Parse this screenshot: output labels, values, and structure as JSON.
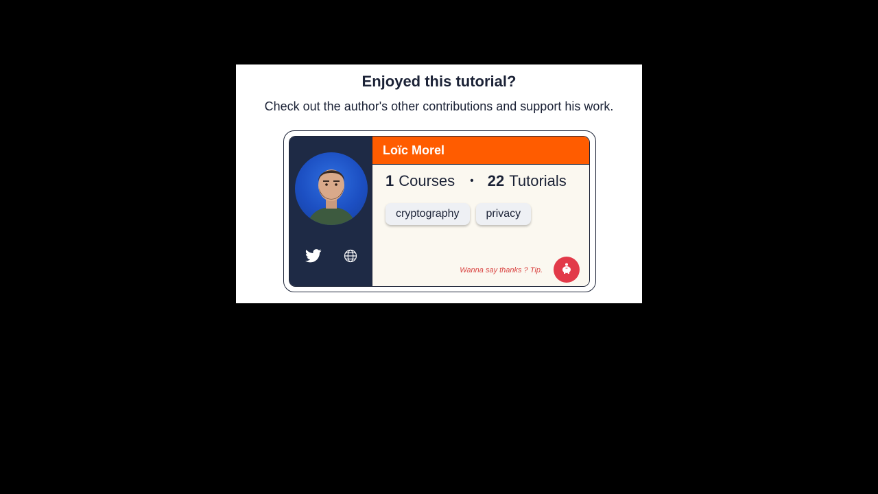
{
  "modal": {
    "title": "Enjoyed this tutorial?",
    "subtitle": "Check out the author's other contributions and support his work."
  },
  "author": {
    "name": "Loïc Morel",
    "courses_count": "1",
    "courses_label": "Courses",
    "separator": "•",
    "tutorials_count": "22",
    "tutorials_label": "Tutorials",
    "tags": [
      "cryptography",
      "privacy"
    ],
    "tip_text": "Wanna say thanks ? Tip."
  },
  "icons": {
    "twitter": "twitter-icon",
    "website": "globe-icon",
    "tip": "piggy-bank-icon"
  },
  "colors": {
    "header_orange": "#ff5c00",
    "sidebar_navy": "#1e2a45",
    "tip_red": "#e23a49",
    "card_bg": "#fbf8f0"
  }
}
